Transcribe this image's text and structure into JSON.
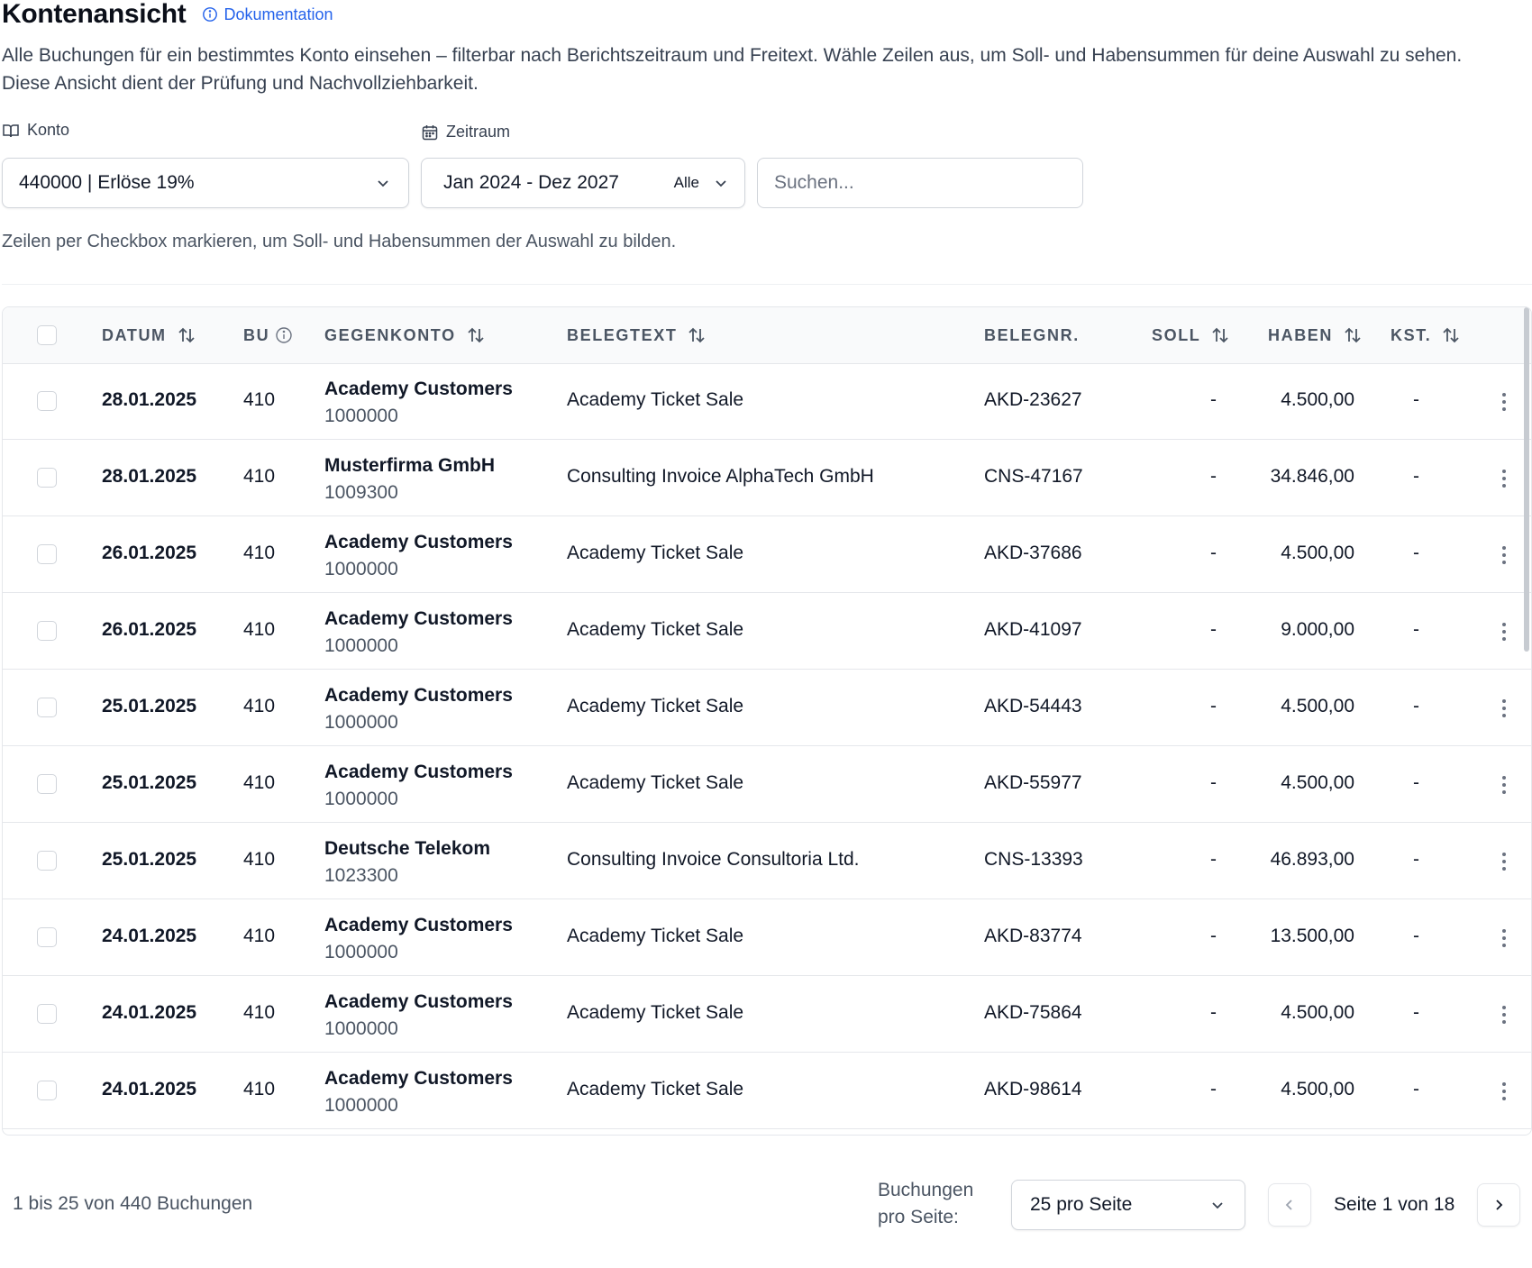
{
  "header": {
    "title": "Kontenansicht",
    "doc_link": "Dokumentation",
    "description": "Alle Buchungen für ein bestimmtes Konto einsehen – filterbar nach Berichtszeitraum und Freitext. Wähle Zeilen aus, um Soll- und Habensummen für deine Auswahl zu sehen. Diese Ansicht dient der Prüfung und Nachvollziehbarkeit."
  },
  "filters": {
    "konto_label": "Konto",
    "konto_value": "440000 | Erlöse 19%",
    "zeitraum_label": "Zeitraum",
    "zeitraum_value": "Jan 2024 - Dez 2027",
    "zeitraum_preset": "Alle",
    "search_placeholder": "Suchen...",
    "hint": "Zeilen per Checkbox markieren, um Soll- und Habensummen der Auswahl zu bilden."
  },
  "table": {
    "columns": {
      "datum": "DATUM",
      "bu": "BU",
      "gegenkonto": "GEGENKONTO",
      "belegtext": "BELEGTEXT",
      "belegnr": "BELEGNR.",
      "soll": "SOLL",
      "haben": "HABEN",
      "kst": "KST."
    },
    "rows": [
      {
        "datum": "28.01.2025",
        "bu": "410",
        "gk_name": "Academy Customers",
        "gk_num": "1000000",
        "belegtext": "Academy Ticket Sale",
        "belegnr": "AKD-23627",
        "soll": "-",
        "haben": "4.500,00",
        "kst": "-"
      },
      {
        "datum": "28.01.2025",
        "bu": "410",
        "gk_name": "Musterfirma GmbH",
        "gk_num": "1009300",
        "belegtext": "Consulting Invoice AlphaTech GmbH",
        "belegnr": "CNS-47167",
        "soll": "-",
        "haben": "34.846,00",
        "kst": "-"
      },
      {
        "datum": "26.01.2025",
        "bu": "410",
        "gk_name": "Academy Customers",
        "gk_num": "1000000",
        "belegtext": "Academy Ticket Sale",
        "belegnr": "AKD-37686",
        "soll": "-",
        "haben": "4.500,00",
        "kst": "-"
      },
      {
        "datum": "26.01.2025",
        "bu": "410",
        "gk_name": "Academy Customers",
        "gk_num": "1000000",
        "belegtext": "Academy Ticket Sale",
        "belegnr": "AKD-41097",
        "soll": "-",
        "haben": "9.000,00",
        "kst": "-"
      },
      {
        "datum": "25.01.2025",
        "bu": "410",
        "gk_name": "Academy Customers",
        "gk_num": "1000000",
        "belegtext": "Academy Ticket Sale",
        "belegnr": "AKD-54443",
        "soll": "-",
        "haben": "4.500,00",
        "kst": "-"
      },
      {
        "datum": "25.01.2025",
        "bu": "410",
        "gk_name": "Academy Customers",
        "gk_num": "1000000",
        "belegtext": "Academy Ticket Sale",
        "belegnr": "AKD-55977",
        "soll": "-",
        "haben": "4.500,00",
        "kst": "-"
      },
      {
        "datum": "25.01.2025",
        "bu": "410",
        "gk_name": "Deutsche Telekom",
        "gk_num": "1023300",
        "belegtext": "Consulting Invoice Consultoria Ltd.",
        "belegnr": "CNS-13393",
        "soll": "-",
        "haben": "46.893,00",
        "kst": "-"
      },
      {
        "datum": "24.01.2025",
        "bu": "410",
        "gk_name": "Academy Customers",
        "gk_num": "1000000",
        "belegtext": "Academy Ticket Sale",
        "belegnr": "AKD-83774",
        "soll": "-",
        "haben": "13.500,00",
        "kst": "-"
      },
      {
        "datum": "24.01.2025",
        "bu": "410",
        "gk_name": "Academy Customers",
        "gk_num": "1000000",
        "belegtext": "Academy Ticket Sale",
        "belegnr": "AKD-75864",
        "soll": "-",
        "haben": "4.500,00",
        "kst": "-"
      },
      {
        "datum": "24.01.2025",
        "bu": "410",
        "gk_name": "Academy Customers",
        "gk_num": "1000000",
        "belegtext": "Academy Ticket Sale",
        "belegnr": "AKD-98614",
        "soll": "-",
        "haben": "4.500,00",
        "kst": "-"
      }
    ]
  },
  "footer": {
    "summary": "1 bis 25 von 440 Buchungen",
    "per_page_label_line1": "Buchungen",
    "per_page_label_line2": "pro Seite:",
    "per_page_value": "25 pro Seite",
    "page_info": "Seite 1 von 18"
  }
}
